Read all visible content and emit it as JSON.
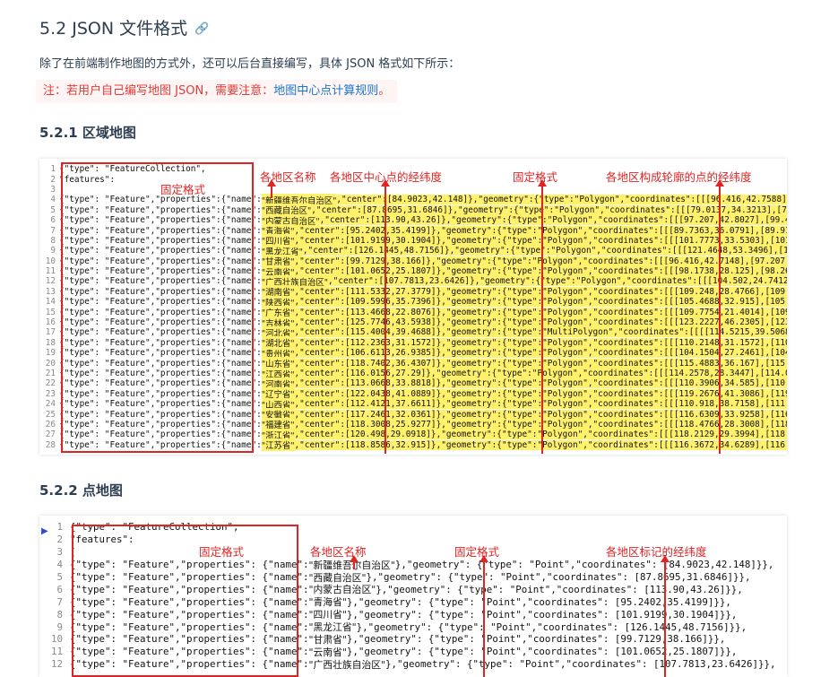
{
  "section_title": "5.2 JSON 文件格式",
  "intro": "除了在前端制作地图的方式外，还可以后台直接编写，具体 JSON 格式如下所示：",
  "notice": {
    "prefix": "注：若用户自己编写地图 JSON，需要注意：",
    "link": "地图中心点计算规则",
    "suffix": "。"
  },
  "region_map": {
    "heading": "5.2.1 区域地图",
    "annotations": {
      "fixed_format_1": "固定格式",
      "region_name": "各地区名称",
      "center_coord": "各地区中心点的经纬度",
      "fixed_format_2": "固定格式",
      "outline_coord": "各地区构成轮廓的点的经纬度"
    },
    "lines": [
      {
        "n": "1",
        "pre": "{\"type\": \"FeatureCollection\",",
        "name": "",
        "post": ""
      },
      {
        "n": "2",
        "pre": "\"features\":",
        "name": "",
        "post": ""
      },
      {
        "n": "3",
        "pre": "[",
        "name": "",
        "post": ""
      },
      {
        "n": "4",
        "pre": "{\"type\": \"Feature\",\"properties\":{\"name\":",
        "name": "\"新疆维吾尔自治区\"",
        "post": ",\"center\":[84.9023,42.148]},\"geometry\":{\"type\":\"Polygon\",\"coordinates\":[[[96.416,42.7588],[96.416"
      },
      {
        "n": "5",
        "pre": "{\"type\": \"Feature\",\"properties\":{\"name\":",
        "name": "\"西藏自治区\"",
        "post": ",\"center\":[87.8695,31.6846]},\"geometry\":{\"type\":\"Polygon\",\"coordinates\":[[[79.0137,34.3213],[79.1016,34"
      },
      {
        "n": "6",
        "pre": "{\"type\": \"Feature\",\"properties\":{\"name\":",
        "name": "\"内蒙古自治区\"",
        "post": ",\"center\":[113.90,43.26]},\"geometry\":{\"type\":\"Polygon\",\"coordinates\":[[[97.207,42.8027],[99.4922,42.5"
      },
      {
        "n": "7",
        "pre": "{\"type\": \"Feature\",\"properties\":{\"name\":",
        "name": "\"青海省\"",
        "post": ",\"center\":[95.2402,35.4199]},\"geometry\":{\"type\":\"Polygon\",\"coordinates\":[[[89.7363,36.0791],[89.9121,36.079"
      },
      {
        "n": "8",
        "pre": "{\"type\": \"Feature\",\"properties\":{\"name\":",
        "name": "\"四川省\"",
        "post": ",\"center\":[101.9199,30.1904]},\"geometry\":{\"type\":\"Polygon\",\"coordinates\":[[[101.7773,33.5303],[101.8652,33"
      },
      {
        "n": "9",
        "pre": "{\"type\": \"Feature\",\"properties\":{\"name\":",
        "name": "\"黑龙江省\"",
        "post": ",\"center\":[126.1445,48.7156]},\"geometry\":{\"type\":\"Polygon\",\"coordinates\":[[[121.4648,53.3496],[123.6621,5"
      },
      {
        "n": "10",
        "pre": "{\"type\": \"Feature\",\"properties\":{\"name\":",
        "name": "\"甘肃省\"",
        "post": ",\"center\":[99.7129,38.166]},\"geometry\":{\"type\":\"Polygon\",\"coordinates\":[[[96.416,42.7148],[97.207,42.8027]"
      },
      {
        "n": "11",
        "pre": "{\"type\": \"Feature\",\"properties\":{\"name\":",
        "name": "\"云南省\"",
        "post": ",\"center\":[101.0652,25.1807]},\"geometry\":{\"type\":\"Polygon\",\"coordinates\":[[[98.1738,28.125],[98.2617,28.388"
      },
      {
        "n": "12",
        "pre": "{\"type\": \"Feature\",\"properties\":{\"name\":",
        "name": "\"广西壮族自治区\"",
        "post": ",\"center\":[107.7813,23.6426]},\"geometry\":{\"type\":\"Polygon\",\"coordinates\":[[[104.502,24.7412],[104.6"
      },
      {
        "n": "13",
        "pre": "{\"type\": \"Feature\",\"properties\":{\"name\":",
        "name": "\"湖南省\"",
        "post": ",\"center\":[111.5332,27.3779]},\"geometry\":{\"type\":\"Polygon\",\"coordinates\":[[[109.248,28.4766],[109.248,29.1"
      },
      {
        "n": "14",
        "pre": "{\"type\": \"Feature\",\"properties\":{\"name\":",
        "name": "\"陕西省\"",
        "post": ",\"center\":[109.5996,35.7396]},\"geometry\":{\"type\":\"Polygon\",\"coordinates\":[[[105.4688,32.915],[105.9082,33.0"
      },
      {
        "n": "15",
        "pre": "{\"type\": \"Feature\",\"properties\":{\"name\":",
        "name": "\"广东省\"",
        "post": ",\"center\":[113.4668,22.8076]},\"geometry\":{\"type\":\"Polygon\",\"coordinates\":[[[109.7754,21.4014],[109.7754,21"
      },
      {
        "n": "16",
        "pre": "{\"type\": \"Feature\",\"properties\":{\"name\":",
        "name": "\"吉林省\"",
        "post": ",\"center\":[125.7746,43.5938]},\"geometry\":{\"type\":\"Polygon\",\"coordinates\":[[[123.2227,46.2305],[123.9258,46"
      },
      {
        "n": "17",
        "pre": "{\"type\": \"Feature\",\"properties\":{\"name\":",
        "name": "\"河北省\"",
        "post": ",\"center\":[115.4004,39.4688]},\"geometry\":{\"type\":\"MultiPolygon\",\"coordinates\":[[[[114.5215,39.5068],[114.34"
      },
      {
        "n": "18",
        "pre": "{\"type\": \"Feature\",\"properties\":{\"name\":",
        "name": "\"湖北省\"",
        "post": ",\"center\":[112.2363,31.1572]},\"geometry\":{\"type\":\"Polygon\",\"coordinates\":[[[110.2148,31.1572],[110.127,31."
      },
      {
        "n": "19",
        "pre": "{\"type\": \"Feature\",\"properties\":{\"name\":",
        "name": "\"贵州省\"",
        "post": ",\"center\":[106.6113,26.9385]},\"geometry\":{\"type\":\"Polygon\",\"coordinates\":[[[104.1504,27.2461],[104.4141,27"
      },
      {
        "n": "20",
        "pre": "{\"type\": \"Feature\",\"properties\":{\"name\":",
        "name": "\"山东省\"",
        "post": ",\"center\":[118.7402,36.4307]},\"geometry\":{\"type\":\"Polygon\",\"coordinates\":[[[115.4883,36.167],[115.3125,36.5"
      },
      {
        "n": "21",
        "pre": "{\"type\": \"Feature\",\"properties\":{\"name\":",
        "name": "\"江西省\"",
        "post": ",\"center\":[116.0156,27.29]},\"geometry\":{\"type\":\"Polygon\",\"coordinates\":[[[114.2578,28.3447],[114.082,28.564"
      },
      {
        "n": "22",
        "pre": "{\"type\": \"Feature\",\"properties\":{\"name\":",
        "name": "\"河南省\"",
        "post": ",\"center\":[113.0668,33.8818]},\"geometry\":{\"type\":\"Polygon\",\"coordinates\":[[[110.3906,34.585],[110.8301,34.6"
      },
      {
        "n": "23",
        "pre": "{\"type\": \"Feature\",\"properties\":{\"name\":",
        "name": "\"辽宁省\"",
        "post": ",\"center\":[122.0438,41.0889]},\"geometry\":{\"type\":\"Polygon\",\"coordinates\":[[[119.2676,41.3086],[119.4434,41"
      },
      {
        "n": "24",
        "pre": "{\"type\": \"Feature\",\"properties\":{\"name\":",
        "name": "\"山西省\"",
        "post": ",\"center\":[112.4121,37.6611]},\"geometry\":{\"type\":\"Polygon\",\"coordinates\":[[[110.918,38.7158],[111.1816,39.2"
      },
      {
        "n": "25",
        "pre": "{\"type\": \"Feature\",\"properties\":{\"name\":",
        "name": "\"安徽省\"",
        "post": ",\"center\":[117.2461,32.0361]},\"geometry\":{\"type\":\"Polygon\",\"coordinates\":[[[116.6309,33.9258],[116.543,34.2"
      },
      {
        "n": "26",
        "pre": "{\"type\": \"Feature\",\"properties\":{\"name\":",
        "name": "\"福建省\"",
        "post": ",\"center\":[118.3008,25.9277]},\"geometry\":{\"type\":\"Polygon\",\"coordinates\":[[[118.4766,28.3008],[118.8281,28"
      },
      {
        "n": "27",
        "pre": "{\"type\": \"Feature\",\"properties\":{\"name\":",
        "name": "\"浙江省\"",
        "post": ",\"center\":[120.498,29.0918]},\"geometry\":{\"type\":\"Polygon\",\"coordinates\":[[[118.2129,29.3994],[118.7402,29."
      },
      {
        "n": "28",
        "pre": "{\"type\": \"Feature\",\"properties\":{\"name\":",
        "name": "\"江苏省\"",
        "post": ",\"center\":[118.8586,32.915]},\"geometry\":{\"type\":\"Polygon\",\"coordinates\":[[[116.3672,34.6289],[116.4551,34.8"
      }
    ]
  },
  "point_map": {
    "heading": "5.2.2 点地图",
    "annotations": {
      "fixed_format_1": "固定格式",
      "region_name": "各地区名称",
      "fixed_format_2": "固定格式",
      "marker_coord": "各地区标记的经纬度"
    },
    "lines": [
      {
        "n": "1",
        "pre": "{\"type\": \"FeatureCollection\",",
        "name": "",
        "post": ""
      },
      {
        "n": "2",
        "pre": "\"features\":",
        "name": "",
        "post": ""
      },
      {
        "n": "3",
        "pre": "[",
        "name": "",
        "post": ""
      },
      {
        "n": "4",
        "pre": "{\"type\": \"Feature\",\"properties\": {\"name\":",
        "name": "\"新疆维吾尔自治区\"",
        "post": "},\"geometry\": {\"type\": \"Point\",\"coordinates\": [84.9023,42.148]}},"
      },
      {
        "n": "5",
        "pre": "{\"type\": \"Feature\",\"properties\": {\"name\":",
        "name": "\"西藏自治区\"",
        "post": "},\"geometry\": {\"type\": \"Point\",\"coordinates\": [87.8695,31.6846]}},"
      },
      {
        "n": "6",
        "pre": "{\"type\": \"Feature\",\"properties\": {\"name\":",
        "name": "\"内蒙古自治区\"",
        "post": "},\"geometry\": {\"type\": \"Point\",\"coordinates\": [113.90,43.26]}},"
      },
      {
        "n": "7",
        "pre": "{\"type\": \"Feature\",\"properties\": {\"name\":",
        "name": "\"青海省\"",
        "post": "},\"geometry\": {\"type\": \"Point\",\"coordinates\": [95.2402,35.4199]}},"
      },
      {
        "n": "8",
        "pre": "{\"type\": \"Feature\",\"properties\": {\"name\":",
        "name": "\"四川省\"",
        "post": "},\"geometry\": {\"type\": \"Point\",\"coordinates\": [101.9199,30.1904]}},"
      },
      {
        "n": "9",
        "pre": "{\"type\": \"Feature\",\"properties\": {\"name\":",
        "name": "\"黑龙江省\"",
        "post": "},\"geometry\": {\"type\": \"Point\",\"coordinates\": [126.1445,48.7156]}},"
      },
      {
        "n": "10",
        "pre": "{\"type\": \"Feature\",\"properties\": {\"name\":",
        "name": "\"甘肃省\"",
        "post": "},\"geometry\": {\"type\": \"Point\",\"coordinates\": [99.7129,38.166]}},"
      },
      {
        "n": "11",
        "pre": "{\"type\": \"Feature\",\"properties\": {\"name\":",
        "name": "\"云南省\"",
        "post": "},\"geometry\": {\"type\": \"Point\",\"coordinates\": [101.0652,25.1807]}},"
      },
      {
        "n": "12",
        "pre": "{\"type\": \"Feature\",\"properties\": {\"name\":",
        "name": "\"广西壮族自治区\"",
        "post": "},\"geometry\": {\"type\": \"Point\",\"coordinates\": [107.7813,23.6426]}},"
      }
    ]
  },
  "colors": {
    "heading": "#2c3e50",
    "notice_red": "#e53935",
    "notice_link": "#1976d2",
    "annotation_red": "#e02424",
    "name_highlight": "#fff16b"
  }
}
